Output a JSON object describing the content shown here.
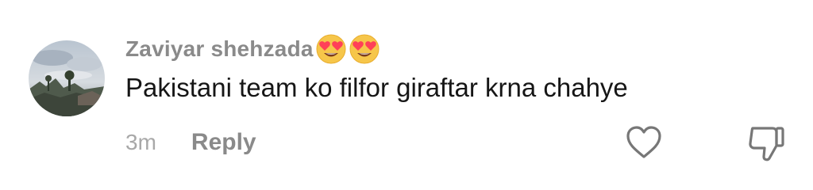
{
  "comment": {
    "username": "Zaviyar shehzada",
    "username_emojis": [
      "heart-eyes-emoji",
      "heart-eyes-emoji"
    ],
    "text": "Pakistani team ko filfor giraftar krna chahye",
    "timestamp": "3m",
    "reply_label": "Reply"
  },
  "icons": {
    "like": "heart-outline-icon",
    "dislike": "thumbs-down-outline-icon"
  },
  "colors": {
    "username": "#8a8a8a",
    "text": "#161616",
    "timestamp": "#a8a8a8",
    "reply": "#8a8a8a",
    "icon_stroke": "#777777",
    "emoji_face": "#f6c64a",
    "emoji_heart": "#ff4058"
  }
}
